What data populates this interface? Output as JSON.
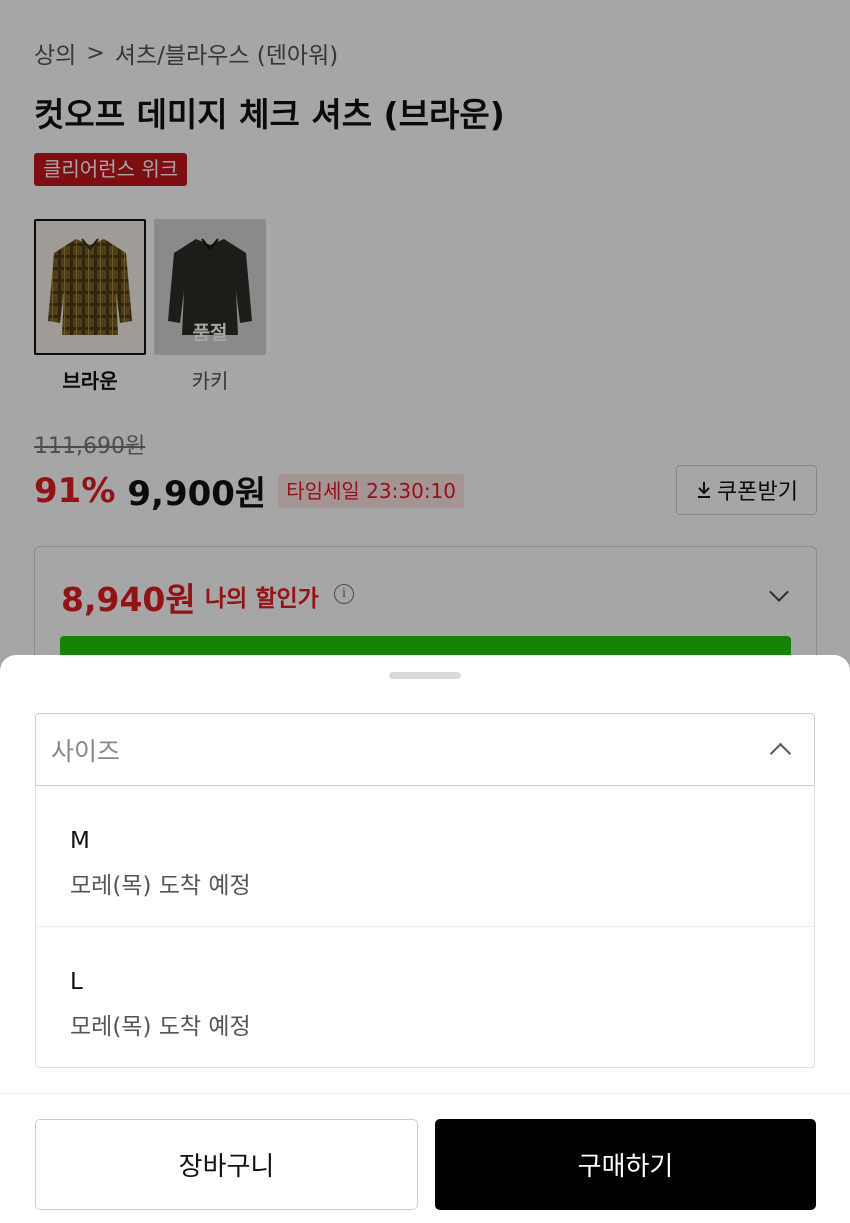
{
  "breadcrumb": {
    "category": "상의",
    "separator": ">",
    "subcategory": "셔츠/블라우스 (덴아워)"
  },
  "product": {
    "title": "컷오프 데미지 체크 셔츠 (브라운)",
    "event_badge": "클리어런스 위크"
  },
  "colors": [
    {
      "name": "브라운",
      "selected": true,
      "sold_out": false
    },
    {
      "name": "카키",
      "selected": false,
      "sold_out": true,
      "sold_out_label": "품절"
    }
  ],
  "pricing": {
    "original": "111,690원",
    "discount_rate": "91%",
    "price": "9,900원",
    "timesale": "타임세일 23:30:10",
    "coupon_button": "쿠폰받기",
    "my_price": "8,940원",
    "my_price_label": "나의 할인가"
  },
  "size_select": {
    "placeholder": "사이즈",
    "options": [
      {
        "name": "M",
        "status": "모레(목) 도착 예정"
      },
      {
        "name": "L",
        "status": "모레(목) 도착 예정"
      }
    ]
  },
  "actions": {
    "cart": "장바구니",
    "buy": "구매하기"
  },
  "colors_theme": {
    "accent_red": "#e31b23",
    "badge_red": "#c4161c",
    "buy_button": "#000000",
    "banner_green": "#22c80e"
  }
}
